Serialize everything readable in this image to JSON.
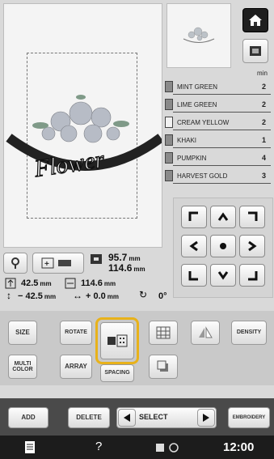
{
  "preview": {
    "design_text": "Flower"
  },
  "thread_list": {
    "header": "min",
    "items": [
      {
        "name": "MINT GREEN",
        "count": "2"
      },
      {
        "name": "LIME GREEN",
        "count": "2"
      },
      {
        "name": "CREAM YELLOW",
        "count": "2"
      },
      {
        "name": "KHAKI",
        "count": "1"
      },
      {
        "name": "PUMPKIN",
        "count": "4"
      },
      {
        "name": "HARVEST GOLD",
        "count": "3"
      }
    ]
  },
  "info": {
    "size_w": "95.7",
    "size_h": "114.6",
    "unit": "mm",
    "x_value": "42.5",
    "width_value": "114.6",
    "offset_y": "− 42.5",
    "offset_x": "+ 0.0",
    "rotation": "0°"
  },
  "buttons": {
    "size": "SIZE",
    "rotate": "ROTATE",
    "density": "DENSITY",
    "multi_color_1": "MULTI",
    "multi_color_2": "COLOR",
    "array": "ARRAY",
    "spacing": "SPACING",
    "add": "ADD",
    "delete": "DELETE",
    "select": "SELECT",
    "embroidery": "EMBROIDERY"
  },
  "status": {
    "help": "?",
    "time": "12:00"
  },
  "colors": {
    "highlight": "#e8b21a",
    "status_bg": "#1c1c1c"
  }
}
